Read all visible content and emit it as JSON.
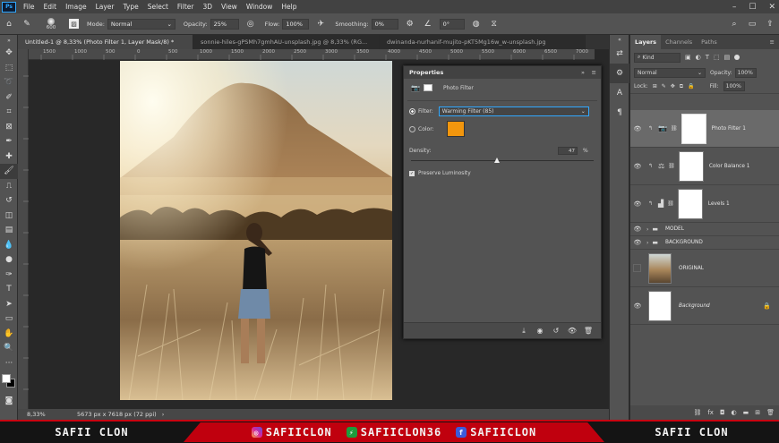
{
  "menu": {
    "items": [
      "File",
      "Edit",
      "Image",
      "Layer",
      "Type",
      "Select",
      "Filter",
      "3D",
      "View",
      "Window",
      "Help"
    ]
  },
  "options": {
    "brush_size": "600",
    "mode_label": "Mode:",
    "mode_value": "Normal",
    "opacity_label": "Opacity:",
    "opacity_value": "25%",
    "flow_label": "Flow:",
    "flow_value": "100%",
    "smoothing_label": "Smoothing:",
    "smoothing_value": "0%",
    "angle_value": "0°"
  },
  "tabs": [
    {
      "label": "Untitled-1 @ 8,33% (Photo Filter 1, Layer Mask/8) *"
    },
    {
      "label": "sonnie-hiles-gPSMh7gmhAU-unsplash.jpg @ 8,33% (RG..."
    },
    {
      "label": "dwinanda-nurhanif-mujito-pKT5Mg16w_w-unsplash.jpg"
    }
  ],
  "ruler": {
    "top": [
      "1500",
      "1000",
      "500",
      "0",
      "500",
      "1000",
      "1500",
      "2000",
      "2500",
      "3000",
      "3500",
      "4000",
      "4500",
      "5000",
      "5500",
      "6000",
      "6500",
      "7000",
      "7500"
    ]
  },
  "status": {
    "zoom": "8,33%",
    "doc": "5673 px x 7618 px (72 ppi)"
  },
  "properties": {
    "title": "Properties",
    "adjustment": "Photo Filter",
    "filter_label": "Filter:",
    "filter_value": "Warming Filter (85)",
    "color_label": "Color:",
    "density_label": "Density:",
    "density_value": "47",
    "density_unit": "%",
    "density_level": 0.47,
    "preserve_label": "Preserve Luminosity",
    "filter_color": "#f2960d"
  },
  "layers_panel": {
    "tabs": [
      "Layers",
      "Channels",
      "Paths"
    ],
    "kind_label": "Kind",
    "blend_mode": "Normal",
    "opacity_label": "Opacity:",
    "opacity_value": "100%",
    "lock_label": "Lock:",
    "fill_label": "Fill:",
    "fill_value": "100%",
    "layers": [
      {
        "name": "Photo Filter 1"
      },
      {
        "name": "Color Balance 1"
      },
      {
        "name": "Levels 1"
      },
      {
        "name": "MODEL"
      },
      {
        "name": "BACKGROUND"
      },
      {
        "name": "ORIGINAL"
      },
      {
        "name": "Background"
      }
    ]
  },
  "banner": {
    "left": "SAFII CLON",
    "instagram": "SAFIICLON",
    "other": "SAFIICLON36",
    "facebook": "SAFIICLON",
    "right": "SAFII CLON"
  },
  "colors": {
    "accent": "#31a8ff",
    "banner_red": "#c0000e"
  }
}
